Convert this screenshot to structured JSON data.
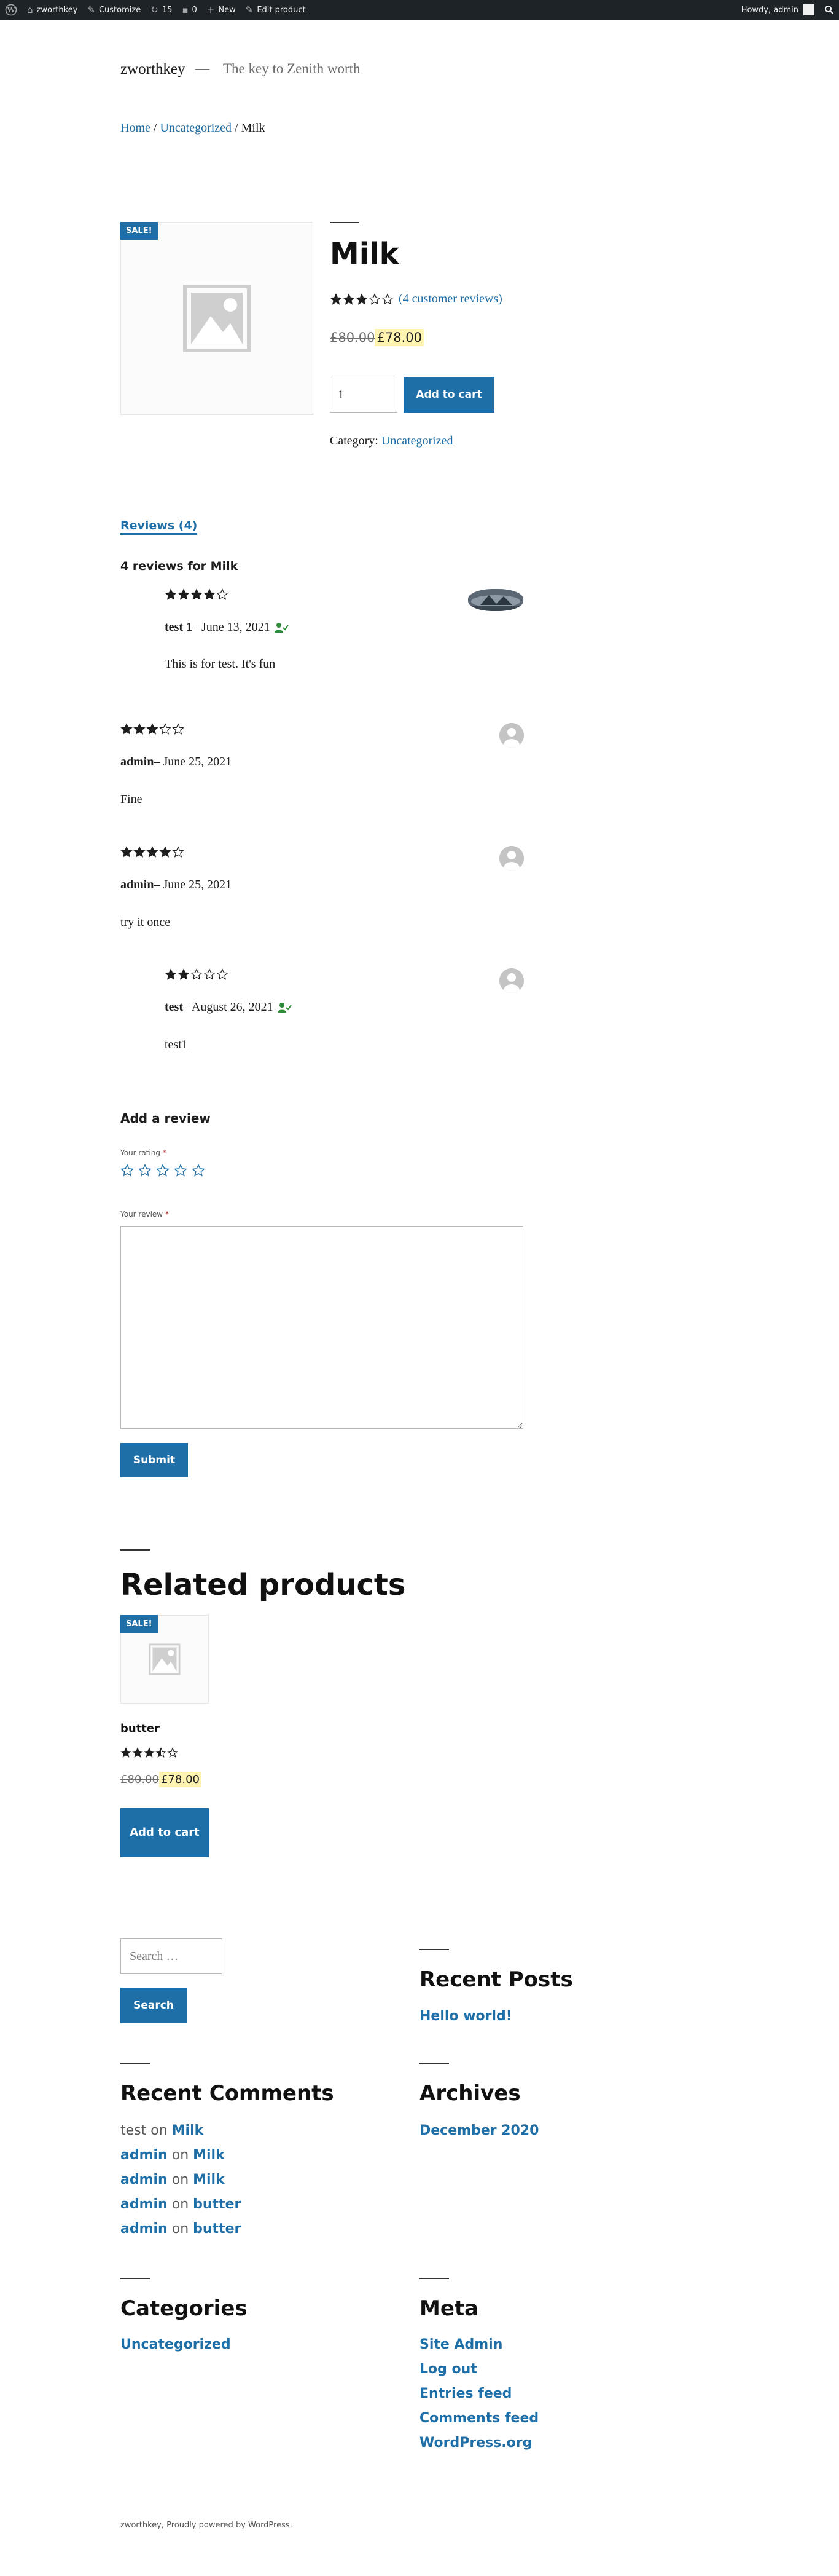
{
  "adminbar": {
    "site_name": "zworthkey",
    "customize": "Customize",
    "updates_count": "15",
    "comments_count": "0",
    "new_label": "New",
    "edit_label": "Edit product",
    "howdy": "Howdy, admin"
  },
  "header": {
    "site_title": "zworthkey",
    "separator": "—",
    "tagline": "The key to Zenith worth"
  },
  "breadcrumb": {
    "home": "Home",
    "sep1": " / ",
    "category": "Uncategorized",
    "sep2": " / ",
    "current": "Milk"
  },
  "product": {
    "sale_badge": "SALE!",
    "title": "Milk",
    "rating": 3,
    "review_link": "(4 customer reviews)",
    "old_price": "£80.00",
    "new_price": "£78.00",
    "quantity": "1",
    "add_to_cart": "Add to cart",
    "category_label": "Category: ",
    "category": "Uncategorized"
  },
  "tabs": {
    "reviews_tab": "Reviews (4)",
    "reviews_heading": "4 reviews for Milk"
  },
  "reviews": [
    {
      "rating": 4,
      "author": "test 1",
      "date": " – June 13, 2021",
      "text": "This is for test. It's fun",
      "verified": true,
      "avatar": "photo"
    },
    {
      "rating": 3,
      "author": "admin",
      "date": " – June 25, 2021",
      "text": "Fine",
      "verified": false,
      "avatar": "default"
    },
    {
      "rating": 4,
      "author": "admin",
      "date": " – June 25, 2021",
      "text": "try it once",
      "verified": false,
      "avatar": "default"
    },
    {
      "rating": 2,
      "author": "test",
      "date": " – August 26, 2021",
      "text": "test1",
      "verified": true,
      "avatar": "default"
    }
  ],
  "add_review": {
    "title": "Add a review",
    "rating_label": "Your rating",
    "review_label": "Your review",
    "required_mark": "*",
    "submit": "Submit"
  },
  "related": {
    "title": "Related products",
    "sale_badge": "SALE!",
    "name": "butter",
    "rating": 3.5,
    "old_price": "£80.00",
    "new_price": "£78.00",
    "add_to_cart": "Add to cart"
  },
  "widgets": {
    "search_placeholder": "Search …",
    "search_button": "Search",
    "recent_posts_title": "Recent Posts",
    "recent_posts": [
      "Hello world!"
    ],
    "recent_comments_title": "Recent Comments",
    "recent_comments": [
      {
        "author": "test",
        "on": " on ",
        "post": "Milk"
      },
      {
        "author": "admin",
        "on": " on ",
        "post": "Milk"
      },
      {
        "author": "admin",
        "on": " on ",
        "post": "Milk"
      },
      {
        "author": "admin",
        "on": " on ",
        "post": "butter"
      },
      {
        "author": "admin",
        "on": " on ",
        "post": "butter"
      }
    ],
    "archives_title": "Archives",
    "archives": [
      "December 2020"
    ],
    "categories_title": "Categories",
    "categories": [
      "Uncategorized"
    ],
    "meta_title": "Meta",
    "meta": [
      "Site Admin",
      "Log out",
      "Entries feed",
      "Comments feed",
      "WordPress.org"
    ]
  },
  "footer": {
    "text": "zworthkey, Proudly powered by WordPress."
  },
  "colors": {
    "accent": "#1e6fa8",
    "adminbar": "#1d2327",
    "price_highlight": "#fff3b0"
  }
}
